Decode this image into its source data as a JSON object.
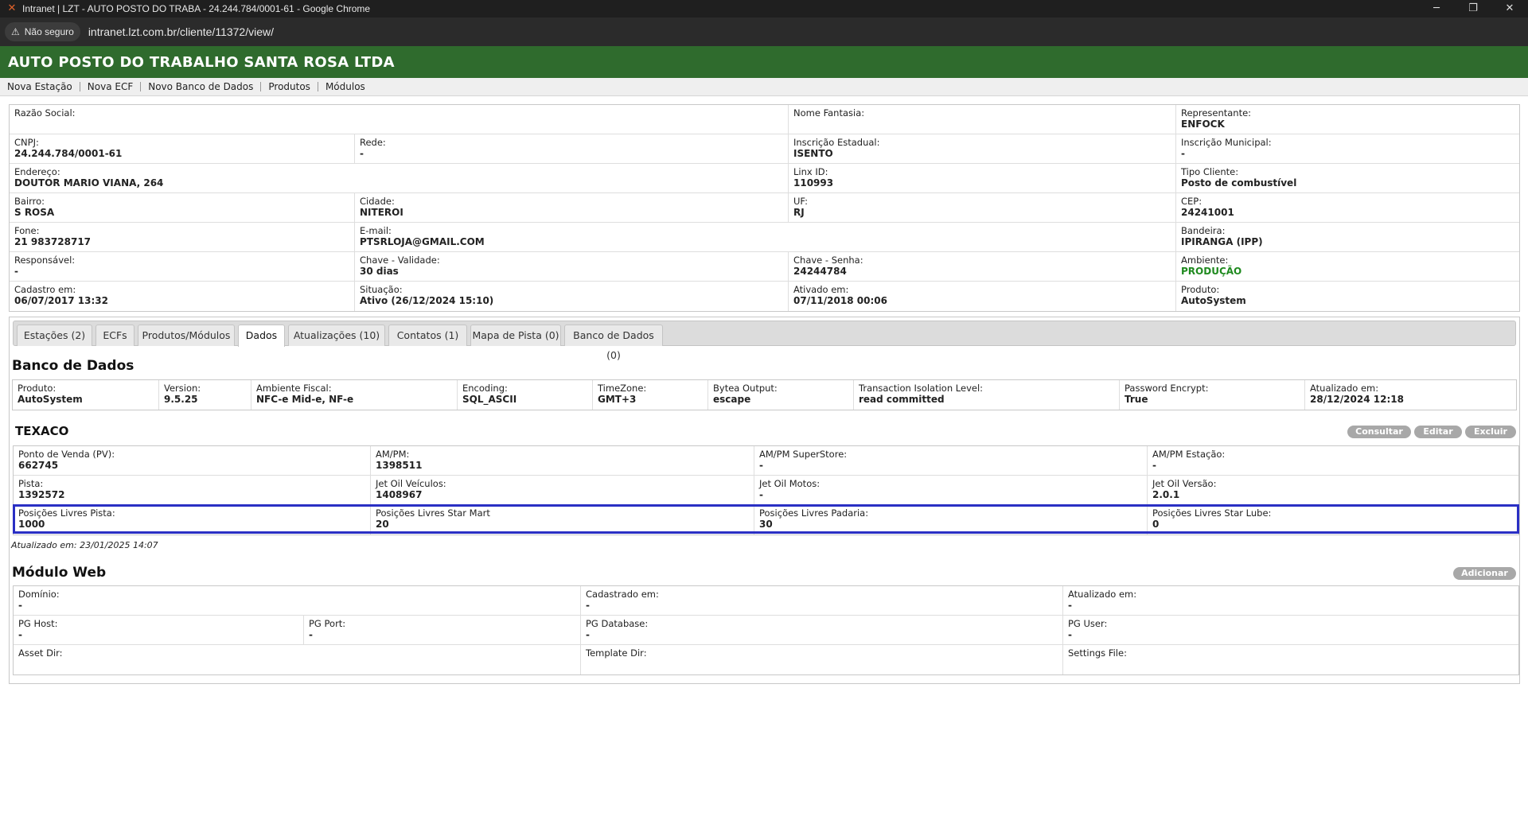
{
  "browser": {
    "window_title": "Intranet | LZT - AUTO POSTO DO TRABA - 24.244.784/0001-61 - Google Chrome",
    "security_label": "Não seguro",
    "url": "intranet.lzt.com.br/cliente/11372/view/"
  },
  "header": {
    "title": "AUTO POSTO DO TRABALHO SANTA ROSA LTDA"
  },
  "subnav": [
    "Nova Estação",
    "Nova ECF",
    "Novo Banco de Dados",
    "Produtos",
    "Módulos"
  ],
  "client": {
    "razao_social": {
      "label": "Razão Social:",
      "value": ""
    },
    "nome_fantasia": {
      "label": "Nome Fantasia:",
      "value": ""
    },
    "representante": {
      "label": "Representante:",
      "value": "ENFOCK"
    },
    "cnpj": {
      "label": "CNPJ:",
      "value": "24.244.784/0001-61"
    },
    "rede": {
      "label": "Rede:",
      "value": "-"
    },
    "inscricao_estadual": {
      "label": "Inscrição Estadual:",
      "value": "ISENTO"
    },
    "inscricao_municipal": {
      "label": "Inscrição Municipal:",
      "value": "-"
    },
    "endereco": {
      "label": "Endereço:",
      "value": "DOUTOR MARIO VIANA, 264"
    },
    "linx_id": {
      "label": "Linx ID:",
      "value": "110993"
    },
    "tipo_cliente": {
      "label": "Tipo Cliente:",
      "value": "Posto de combustível"
    },
    "bairro": {
      "label": "Bairro:",
      "value": "S ROSA"
    },
    "cidade": {
      "label": "Cidade:",
      "value": "NITEROI"
    },
    "uf": {
      "label": "UF:",
      "value": "RJ"
    },
    "cep": {
      "label": "CEP:",
      "value": "24241001"
    },
    "fone": {
      "label": "Fone:",
      "value": "21 983728717"
    },
    "email": {
      "label": "E-mail:",
      "value": "PTSRLOJA@GMAIL.COM"
    },
    "bandeira": {
      "label": "Bandeira:",
      "value": "IPIRANGA (IPP)"
    },
    "responsavel": {
      "label": "Responsável:",
      "value": "-"
    },
    "chave_validade": {
      "label": "Chave - Validade:",
      "value": "30 dias"
    },
    "chave_senha": {
      "label": "Chave - Senha:",
      "value": "24244784"
    },
    "ambiente": {
      "label": "Ambiente:",
      "value": "PRODUÇÃO"
    },
    "cadastro_em": {
      "label": "Cadastro em:",
      "value": "06/07/2017 13:32"
    },
    "situacao": {
      "label": "Situação:",
      "value": "Ativo (26/12/2024 15:10)"
    },
    "ativado_em": {
      "label": "Ativado em:",
      "value": "07/11/2018 00:06"
    },
    "produto": {
      "label": "Produto:",
      "value": "AutoSystem"
    }
  },
  "tabs": [
    "Estações (2)",
    "ECFs",
    "Produtos/Módulos",
    "Dados",
    "Atualizações (10)",
    "Contatos (1)",
    "Mapa de Pista (0)",
    "Banco de Dados (0)"
  ],
  "active_tab": "Dados",
  "db": {
    "title": "Banco de Dados",
    "produto": {
      "label": "Produto:",
      "value": "AutoSystem"
    },
    "version": {
      "label": "Version:",
      "value": "9.5.25"
    },
    "ambiente_fiscal": {
      "label": "Ambiente Fiscal:",
      "value": "NFC-e Mid-e, NF-e"
    },
    "encoding": {
      "label": "Encoding:",
      "value": "SQL_ASCII"
    },
    "timezone": {
      "label": "TimeZone:",
      "value": "GMT+3"
    },
    "bytea_output": {
      "label": "Bytea Output:",
      "value": "escape"
    },
    "isolation": {
      "label": "Transaction Isolation Level:",
      "value": "read committed"
    },
    "password_encrypt": {
      "label": "Password Encrypt:",
      "value": "True"
    },
    "atualizado_em": {
      "label": "Atualizado em:",
      "value": "28/12/2024 12:18"
    }
  },
  "texaco": {
    "title": "TEXACO",
    "buttons": {
      "consultar": "Consultar",
      "editar": "Editar",
      "excluir": "Excluir"
    },
    "pv": {
      "label": "Ponto de Venda (PV):",
      "value": "662745"
    },
    "ampm": {
      "label": "AM/PM:",
      "value": "1398511"
    },
    "ampm_superstore": {
      "label": "AM/PM SuperStore:",
      "value": "-"
    },
    "ampm_estacao": {
      "label": "AM/PM Estação:",
      "value": "-"
    },
    "pista": {
      "label": "Pista:",
      "value": "1392572"
    },
    "jet_oil_veiculos": {
      "label": "Jet Oil Veículos:",
      "value": "1408967"
    },
    "jet_oil_motos": {
      "label": "Jet Oil Motos:",
      "value": "-"
    },
    "jet_oil_versao": {
      "label": "Jet Oil Versão:",
      "value": "2.0.1"
    },
    "pos_pista": {
      "label": "Posições Livres Pista:",
      "value": "1000"
    },
    "pos_starmart": {
      "label": "Posições Livres Star Mart",
      "value": "20"
    },
    "pos_padaria": {
      "label": "Posições Livres Padaria:",
      "value": "30"
    },
    "pos_starlube": {
      "label": "Posições Livres Star Lube:",
      "value": "0"
    },
    "updated_note": "Atualizado em: 23/01/2025 14:07"
  },
  "modulo_web": {
    "title": "Módulo Web",
    "add_button": "Adicionar",
    "dominio": {
      "label": "Domínio:",
      "value": "-"
    },
    "cadastrado_em": {
      "label": "Cadastrado em:",
      "value": "-"
    },
    "atualizado_em": {
      "label": "Atualizado em:",
      "value": "-"
    },
    "pg_host": {
      "label": "PG Host:",
      "value": "-"
    },
    "pg_port": {
      "label": "PG Port:",
      "value": "-"
    },
    "pg_database": {
      "label": "PG Database:",
      "value": "-"
    },
    "pg_user": {
      "label": "PG User:",
      "value": "-"
    },
    "asset_dir": {
      "label": "Asset Dir:",
      "value": ""
    },
    "template_dir": {
      "label": "Template Dir:",
      "value": ""
    },
    "settings_file": {
      "label": "Settings File:",
      "value": ""
    }
  },
  "colors": {
    "header_green": "#2f6b2d",
    "highlight_blue": "#2a2fc4",
    "production_green": "#1f8a1f"
  }
}
